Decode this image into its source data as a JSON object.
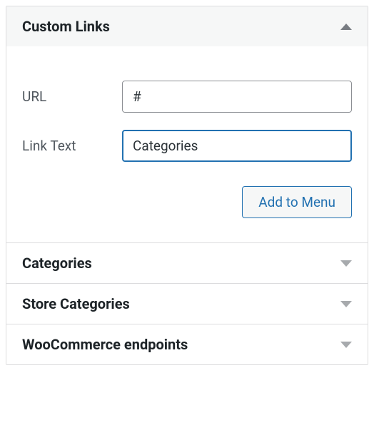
{
  "sections": {
    "custom_links": {
      "title": "Custom Links",
      "expanded": true,
      "url_label": "URL",
      "url_value": "#",
      "link_text_label": "Link Text",
      "link_text_value": "Categories",
      "add_button_label": "Add to Menu"
    },
    "categories": {
      "title": "Categories",
      "expanded": false
    },
    "store_categories": {
      "title": "Store Categories",
      "expanded": false
    },
    "woocommerce_endpoints": {
      "title": "WooCommerce endpoints",
      "expanded": false
    }
  }
}
